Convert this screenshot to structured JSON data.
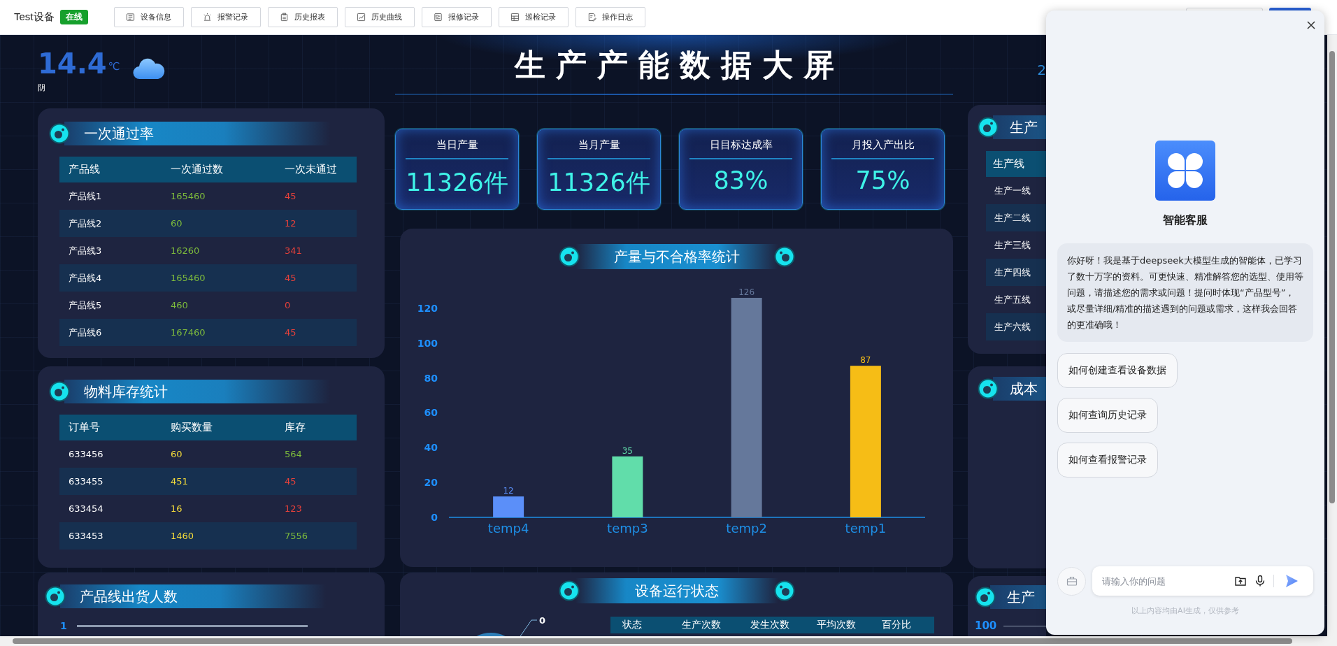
{
  "top_bar": {
    "title": "Test设备",
    "status_badge": "在线",
    "nav_buttons": [
      "设备信息",
      "报警记录",
      "历史报表",
      "历史曲线",
      "报修记录",
      "巡检记录",
      "操作日志"
    ]
  },
  "weather": {
    "temperature": "14.4",
    "unit": "℃",
    "condition": "阴"
  },
  "dashboard_title": "生产产能数据大屏",
  "date_fragment": "2",
  "first_pass_panel": {
    "title": "一次通过率",
    "columns": [
      "产品线",
      "一次通过数",
      "一次未通过"
    ],
    "rows": [
      {
        "line": "产品线1",
        "passed": "165460",
        "failed": "45"
      },
      {
        "line": "产品线2",
        "passed": "60",
        "failed": "12"
      },
      {
        "line": "产品线3",
        "passed": "16260",
        "failed": "341"
      },
      {
        "line": "产品线4",
        "passed": "165460",
        "failed": "45"
      },
      {
        "line": "产品线5",
        "passed": "460",
        "failed": "0"
      },
      {
        "line": "产品线6",
        "passed": "167460",
        "failed": "45"
      }
    ]
  },
  "inventory_panel": {
    "title": "物料库存统计",
    "columns": [
      "订单号",
      "购买数量",
      "库存"
    ],
    "rows": [
      {
        "order": "633456",
        "quantity": "60",
        "stock": "564",
        "color": "#7dbb3c"
      },
      {
        "order": "633455",
        "quantity": "451",
        "stock": "45",
        "color": "#e8413a"
      },
      {
        "order": "633454",
        "quantity": "16",
        "stock": "123",
        "color": "#e8413a"
      },
      {
        "order": "633453",
        "quantity": "1460",
        "stock": "7556",
        "color": "#7dbb3c"
      }
    ]
  },
  "shipment_panel": {
    "title": "产品线出货人数",
    "axis_tick": "1"
  },
  "kpis": [
    {
      "label": "当日产量",
      "value": "11326件"
    },
    {
      "label": "当月产量",
      "value": "11326件"
    },
    {
      "label": "日目标达成率",
      "value": "83%"
    },
    {
      "label": "月投入产出比",
      "value": "75%"
    }
  ],
  "output_chart_panel": {
    "title": "产量与不合格率统计",
    "chart_data": {
      "type": "bar",
      "categories": [
        "temp4",
        "temp3",
        "temp2",
        "temp1"
      ],
      "values": [
        12,
        35,
        126,
        87
      ],
      "colors": [
        "#5b8ff9",
        "#61ddaa",
        "#65789b",
        "#f6bd16"
      ],
      "ylim": [
        0,
        126
      ],
      "yticks": [
        0,
        20,
        40,
        60,
        80,
        100,
        120
      ],
      "data_labels": true
    }
  },
  "equipment_panel": {
    "title": "设备运行状态",
    "pie_label": "0",
    "columns": [
      "状态",
      "生产次数",
      "发生次数",
      "平均次数",
      "百分比"
    ]
  },
  "production_lines_panel": {
    "title": "生产",
    "column": "生产线",
    "rows": [
      "生产一线",
      "生产二线",
      "生产三线",
      "生产四线",
      "生产五线",
      "生产六线"
    ]
  },
  "cost_panel": {
    "title": "成本"
  },
  "production_panel": {
    "title": "生产",
    "axis_tick": "100"
  },
  "chat": {
    "title": "智能客服",
    "message": "你好呀！我是基于deepseek大模型生成的智能体，已学习了数十万字的资料。可更快速、精准解答您的选型、使用等问题，请描述您的需求或问题！提问时体现“产品型号”，或尽量详细/精准的描述遇到的问题或需求，这样我会回答的更准确哦！",
    "suggestions": [
      "如何创建查看设备数据",
      "如何查询历史记录",
      "如何查看报警记录"
    ],
    "input": {
      "placeholder": "请输入你的问题"
    },
    "disclaimer": "以上内容均由AI生成，仅供参考"
  }
}
